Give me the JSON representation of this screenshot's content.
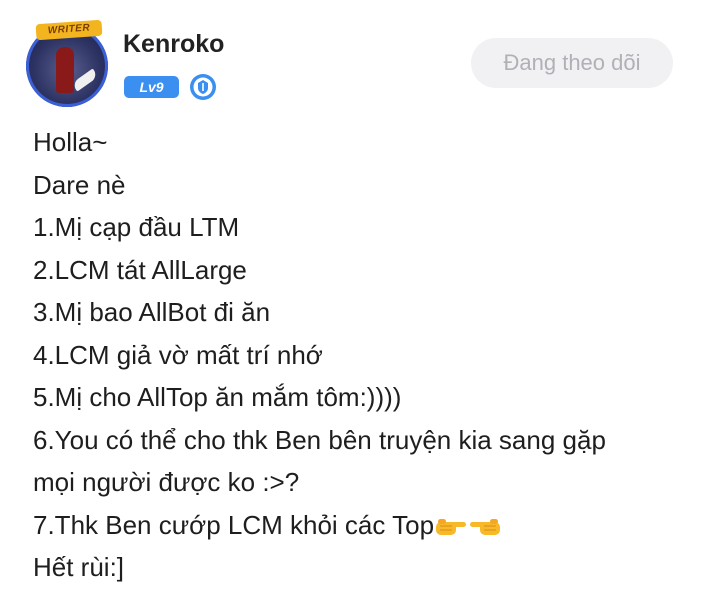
{
  "author": {
    "avatar_badge": "WRITER",
    "name": "Kenroko",
    "level": "Lv9",
    "verified_icon": "verified-shield-icon"
  },
  "follow_button": {
    "label": "Đang theo dõi"
  },
  "post": {
    "lines": [
      "Holla~",
      "Dare nè",
      "1.Mị cạp đầu LTM",
      "2.LCM tát AllLarge",
      "3.Mị bao AllBot đi ăn",
      "4.LCM giả vờ mất trí nhớ",
      "5.Mị cho AllTop ăn mắm tôm:))))",
      "6.You có thể cho thk Ben bên truyện kia sang gặp",
      "mọi người được ko :>?",
      "7.Thk Ben cướp LCM khỏi các Top",
      "Hết rùi:]"
    ],
    "emojis": [
      "point-right-emoji",
      "point-left-emoji"
    ]
  },
  "colors": {
    "level_badge": "#3a8ff0",
    "follow_button_bg": "#f1f1f3",
    "follow_button_text": "#b0b0b6"
  }
}
